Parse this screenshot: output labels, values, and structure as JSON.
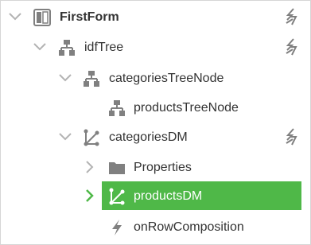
{
  "tree": {
    "items": [
      {
        "label": "FirstForm"
      },
      {
        "label": "idfTree"
      },
      {
        "label": "categoriesTreeNode"
      },
      {
        "label": "productsTreeNode"
      },
      {
        "label": "categoriesDM"
      },
      {
        "label": "Properties"
      },
      {
        "label": "productsDM"
      },
      {
        "label": "onRowComposition"
      }
    ],
    "selected_index": 6
  },
  "colors": {
    "selection": "#4fb848",
    "icon_gray": "#808080",
    "chevron_light": "#b3b3b3",
    "chevron_selected": "#4fb848"
  },
  "icons": {
    "form": "form-icon",
    "tree": "tree-icon",
    "tree_node": "tree-node-icon",
    "datamap": "datamap-icon",
    "folder": "folder-icon",
    "event": "lightning-icon",
    "event_handler": "event-handler-icon"
  }
}
